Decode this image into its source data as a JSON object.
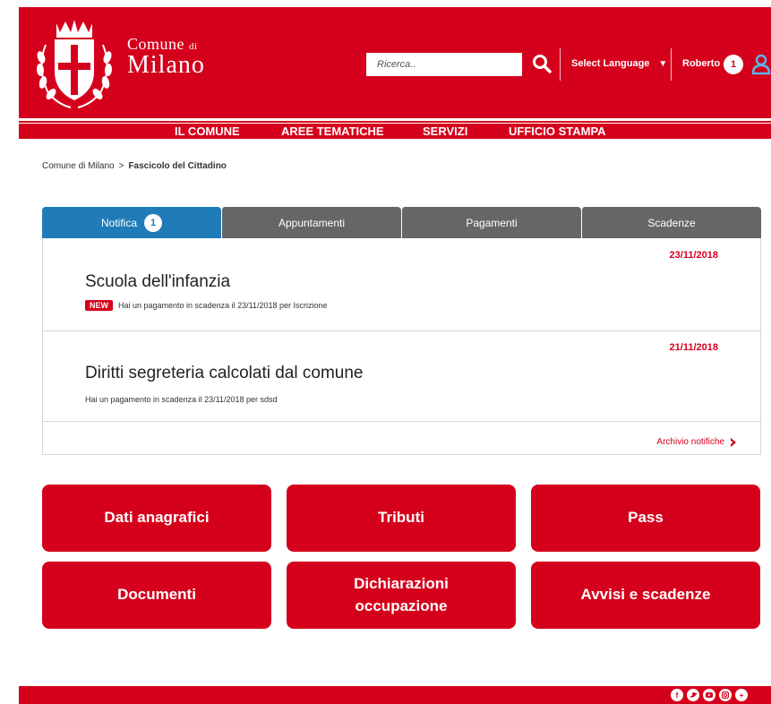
{
  "header": {
    "brand_top": "Comune",
    "brand_di": "di",
    "brand_bottom": "Milano",
    "search_placeholder": "Ricerca..",
    "language_label": "Select Language",
    "user_name": "Roberto",
    "user_badge": "1"
  },
  "nav": {
    "items": [
      "IL COMUNE",
      "AREE TEMATICHE",
      "SERVIZI",
      "UFFICIO STAMPA"
    ]
  },
  "breadcrumb": {
    "home": "Comune di Milano",
    "separator": ">",
    "current": "Fascicolo del Cittadino"
  },
  "tabs": [
    {
      "label": "Notifica",
      "badge": "1"
    },
    {
      "label": "Appuntamenti"
    },
    {
      "label": "Pagamenti"
    },
    {
      "label": "Scadenze"
    }
  ],
  "notifications": [
    {
      "date": "23/11/2018",
      "title": "Scuola dell'infanzia",
      "tag": "NEW",
      "description": "Hai un pagamento in scadenza il 23/11/2018 per Iscrizione"
    },
    {
      "date": "21/11/2018",
      "title": "Diritti segreteria calcolati dal comune",
      "description": "Hai un pagamento in scadenza il 23/11/2018 per sdsd"
    }
  ],
  "archive_link": "Archivio notifiche",
  "tiles": {
    "t1": "Dati anagrafici",
    "t2": "Tributi",
    "t3": "Pass",
    "t4": "Documenti",
    "t5_line1": "Dichiarazioni",
    "t5_line2": "occupazione",
    "t6": "Avvisi e scadenze"
  },
  "footer": {
    "social_icons": [
      "facebook-icon",
      "twitter-icon",
      "youtube-icon",
      "instagram-icon",
      "plus-icon"
    ]
  },
  "colors": {
    "brand_red": "#d5001c",
    "tab_active_blue": "#1f7cb8",
    "tab_inactive_gray": "#666666"
  }
}
